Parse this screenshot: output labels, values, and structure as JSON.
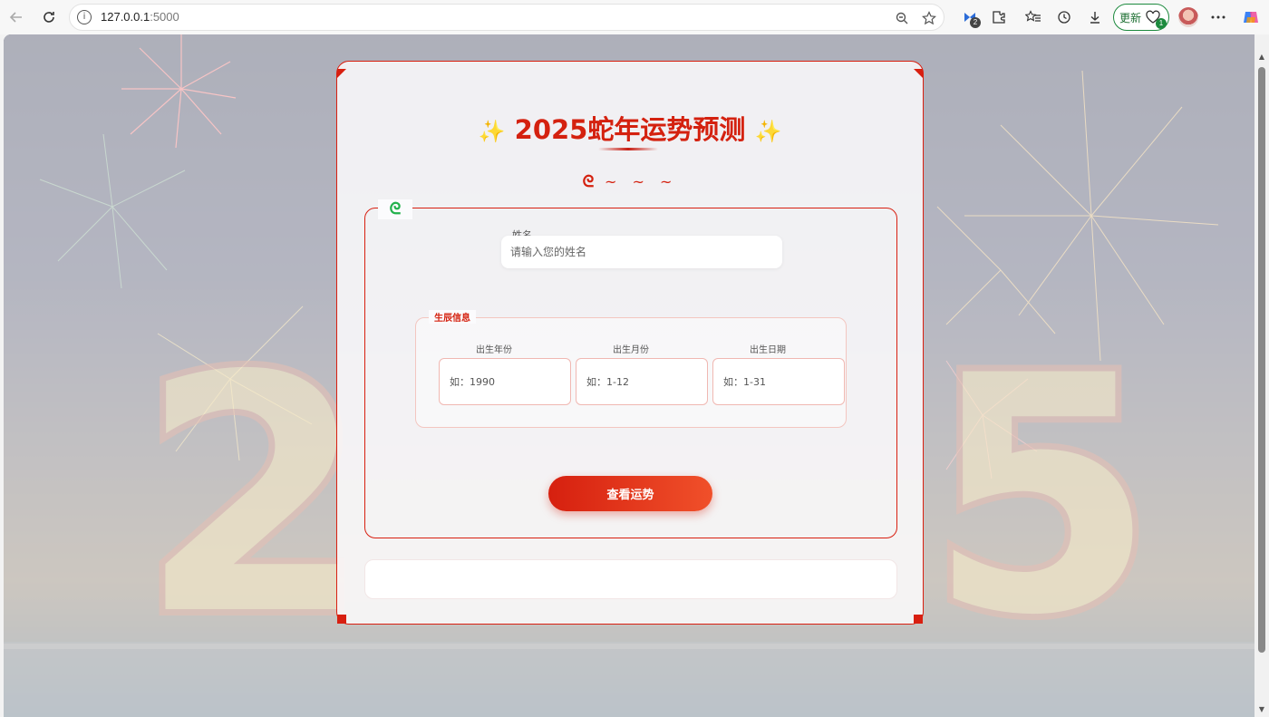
{
  "browser": {
    "url_host": "127.0.0.1",
    "url_port": ":5000",
    "update_label": "更新",
    "extension_badge": "2",
    "update_badge": "1"
  },
  "page": {
    "title": "2025蛇年运势预测",
    "sparkle_glyph": "✨",
    "snake_glyph": "ᘓ",
    "tilde_text": "~ ~ ~",
    "name_label": "姓名",
    "name_placeholder": "请输入您的姓名",
    "birth_legend": "生辰信息",
    "birth_year_label": "出生年份",
    "birth_year_placeholder": "如：1990",
    "birth_month_label": "出生月份",
    "birth_month_placeholder": "如：1-12",
    "birth_day_label": "出生日期",
    "birth_day_placeholder": "如：1-31",
    "submit_label": "查看运势",
    "background_digits": [
      "2",
      "5"
    ]
  },
  "colors": {
    "accent_red": "#d4210f",
    "sparkle_gold": "#f3c233",
    "snake_green": "#22b14c"
  }
}
